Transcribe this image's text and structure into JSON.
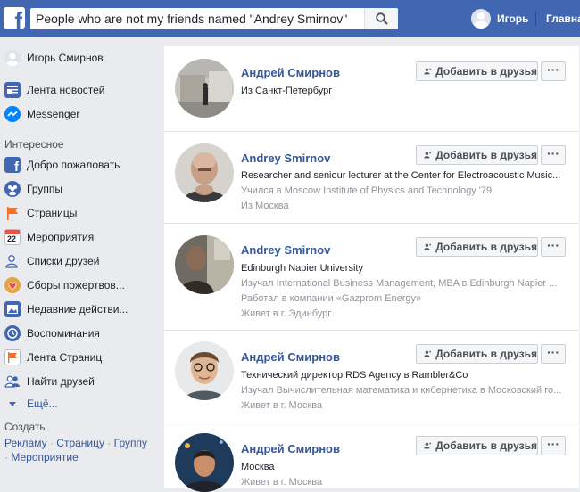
{
  "header": {
    "search_value": "People who are not my friends named \"Andrey Smirnov\"",
    "user_name": "Игорь",
    "home_label": "Главна"
  },
  "sidebar": {
    "profile_name": "Игорь Смирнов",
    "items_top": [
      {
        "label": "Лента новостей",
        "icon": "news-feed-icon",
        "color": "#4267b2"
      },
      {
        "label": "Messenger",
        "icon": "messenger-icon",
        "color": "#0084ff"
      }
    ],
    "section_interesting": "Интересное",
    "items": [
      {
        "label": "Добро пожаловать",
        "icon": "facebook-icon",
        "color": "#4267b2"
      },
      {
        "label": "Группы",
        "icon": "groups-icon",
        "color": "#4267b2"
      },
      {
        "label": "Страницы",
        "icon": "flag-icon",
        "color": "#f36f21"
      },
      {
        "label": "Мероприятия",
        "icon": "calendar-icon",
        "color": "#e4544c"
      },
      {
        "label": "Списки друзей",
        "icon": "friend-lists-icon",
        "color": "#4267b2"
      },
      {
        "label": "Сборы пожертвов...",
        "icon": "fundraiser-icon",
        "color": "#e8a33d"
      },
      {
        "label": "Недавние действи...",
        "icon": "photo-icon",
        "color": "#4267b2"
      },
      {
        "label": "Воспоминания",
        "icon": "memories-icon",
        "color": "#4267b2"
      },
      {
        "label": "Лента Страниц",
        "icon": "pages-feed-icon",
        "color": "#f36f21"
      },
      {
        "label": "Найти друзей",
        "icon": "find-friends-icon",
        "color": "#4267b2"
      }
    ],
    "more_label": "Ещё...",
    "section_create": "Создать",
    "create_links": [
      "Рекламу",
      "Страницу",
      "Группу",
      "Мероприятие"
    ]
  },
  "results": {
    "add_friend_label": "Добавить в друзья",
    "more_label": "···",
    "people": [
      {
        "name": "Андрей Смирнов",
        "lines": [
          "Из Санкт-Петербург"
        ]
      },
      {
        "name": "Andrey Smirnov",
        "lines": [
          "Researcher and seniour lecturer at the Center for Electroacoustic Music...",
          "Учился в Moscow Institute of Physics and Technology '79",
          "Из Москва"
        ]
      },
      {
        "name": "Andrey Smirnov",
        "lines": [
          "Edinburgh Napier University",
          "Изучал International Business Management, MBA в Edinburgh Napier ...",
          "Работал в компании «Gazprom Energy»",
          "Живет в г. Эдинбург"
        ]
      },
      {
        "name": "Андрей Смирнов",
        "lines": [
          "Технический директор RDS Agency в Rambler&Co",
          "Изучал Вычислительная математика и кибернетика в Московский го...",
          "Живет в г. Москва"
        ]
      },
      {
        "name": "Андрей Смирнов",
        "lines": [
          "Москва",
          "Живет в г. Москва"
        ]
      }
    ]
  }
}
